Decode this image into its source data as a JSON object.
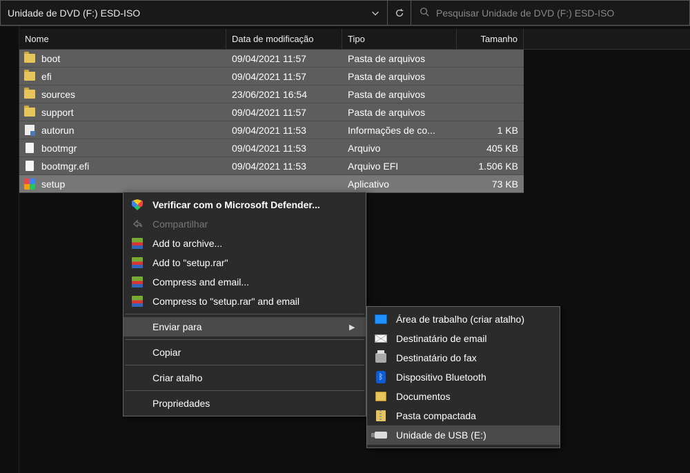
{
  "address": "Unidade de DVD (F:) ESD-ISO",
  "search_placeholder": "Pesquisar Unidade de DVD (F:) ESD-ISO",
  "columns": {
    "name": "Nome",
    "date": "Data de modificação",
    "type": "Tipo",
    "size": "Tamanho"
  },
  "files": [
    {
      "name": "boot",
      "date": "09/04/2021 11:57",
      "type": "Pasta de arquivos",
      "size": "",
      "icon": "folder"
    },
    {
      "name": "efi",
      "date": "09/04/2021 11:57",
      "type": "Pasta de arquivos",
      "size": "",
      "icon": "folder"
    },
    {
      "name": "sources",
      "date": "23/06/2021 16:54",
      "type": "Pasta de arquivos",
      "size": "",
      "icon": "folder"
    },
    {
      "name": "support",
      "date": "09/04/2021 11:57",
      "type": "Pasta de arquivos",
      "size": "",
      "icon": "folder"
    },
    {
      "name": "autorun",
      "date": "09/04/2021 11:53",
      "type": "Informações de co...",
      "size": "1 KB",
      "icon": "inf"
    },
    {
      "name": "bootmgr",
      "date": "09/04/2021 11:53",
      "type": "Arquivo",
      "size": "405 KB",
      "icon": "file"
    },
    {
      "name": "bootmgr.efi",
      "date": "09/04/2021 11:53",
      "type": "Arquivo EFI",
      "size": "1.506 KB",
      "icon": "file"
    },
    {
      "name": "setup",
      "date": "",
      "type": "Aplicativo",
      "size": "73 KB",
      "icon": "exe",
      "selected": true
    }
  ],
  "context_menu": {
    "defender": "Verificar com o Microsoft Defender...",
    "share": "Compartilhar",
    "add_archive": "Add to archive...",
    "add_setup_rar": "Add to \"setup.rar\"",
    "compress_email": "Compress and email...",
    "compress_setup_email": "Compress to \"setup.rar\" and email",
    "send_to": "Enviar para",
    "copy": "Copiar",
    "create_shortcut": "Criar atalho",
    "properties": "Propriedades"
  },
  "send_to_menu": {
    "desktop": "Área de trabalho (criar atalho)",
    "email": "Destinatário de email",
    "fax": "Destinatário do fax",
    "bluetooth": "Dispositivo Bluetooth",
    "documents": "Documentos",
    "zip": "Pasta compactada",
    "usb": "Unidade de USB (E:)"
  }
}
